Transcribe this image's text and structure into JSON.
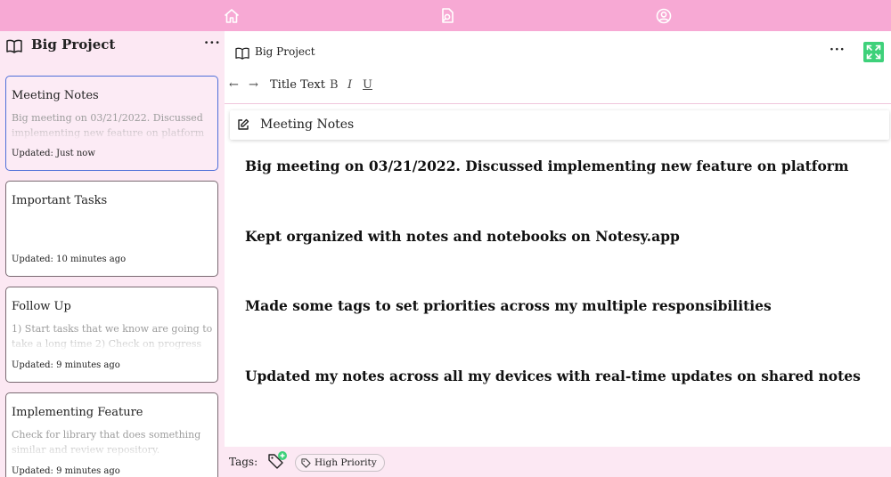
{
  "nav": {
    "icons": [
      "home-icon",
      "search-notes-icon",
      "user-account-icon"
    ]
  },
  "sidebar": {
    "title": "Big Project",
    "more_label": "···",
    "notes": [
      {
        "title": "Meeting Notes",
        "preview": "Big meeting on 03/21/2022. Discussed implementing new feature on platform",
        "updated": "Updated: Just now",
        "selected": true
      },
      {
        "title": "Important Tasks",
        "preview": "",
        "updated": "Updated: 10 minutes ago",
        "selected": false
      },
      {
        "title": "Follow Up",
        "preview": "1) Start tasks that we know are going to take a long time 2) Check on progress",
        "updated": "Updated: 9 minutes ago",
        "selected": false
      },
      {
        "title": "Implementing Feature",
        "preview": "Check for library that does something similar and review repository.",
        "updated": "Updated: 9 minutes ago",
        "selected": false
      }
    ]
  },
  "main": {
    "breadcrumb": "Big Project",
    "more_label": "···",
    "toolbar": {
      "back": "←",
      "forward": "→",
      "title_text": "Title Text",
      "bold": "B",
      "italic": "I",
      "underline": "U"
    },
    "note_title": "Meeting Notes",
    "body": [
      "Big meeting on 03/21/2022.  Discussed implementing new feature on platform",
      "Kept organized with notes and notebooks on Notesy.app",
      "Made some tags to set priorities across my multiple responsibilities",
      "Updated my notes across all my devices with real-time updates on shared notes"
    ],
    "tags": {
      "label": "Tags:",
      "items": [
        "High Priority"
      ]
    }
  },
  "colors": {
    "nav_bg": "#f7a9d4",
    "sidebar_bg": "#fce8f3",
    "selected_border": "#4f6fd9",
    "expand_button": "#3ed17a"
  }
}
